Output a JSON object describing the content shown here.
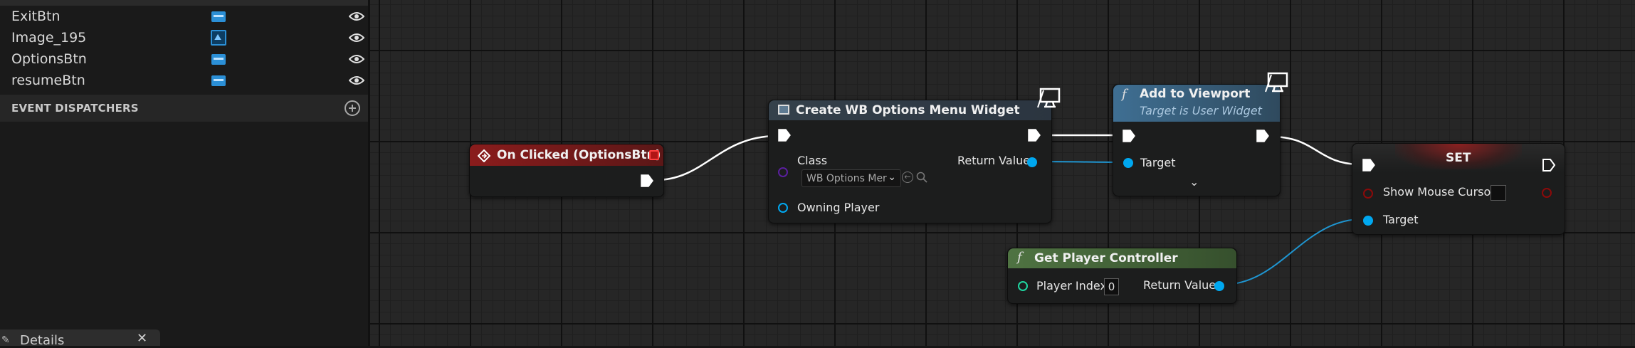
{
  "left_panel": {
    "variables": [
      {
        "name": "ExitBtn",
        "type_icon": "button-widget-icon"
      },
      {
        "name": "Image_195",
        "type_icon": "image-widget-icon"
      },
      {
        "name": "OptionsBtn",
        "type_icon": "button-widget-icon"
      },
      {
        "name": "resumeBtn",
        "type_icon": "button-widget-icon"
      }
    ],
    "section_title": "EVENT DISPATCHERS",
    "details_tab": {
      "label": "Details",
      "close": "✕"
    }
  },
  "graph": {
    "nodes": {
      "on_clicked": {
        "title": "On Clicked (OptionsBtn)",
        "color": "#8a1c1c"
      },
      "create_widget": {
        "title": "Create WB Options Menu Widget",
        "class_label": "Class",
        "class_value": "WB Options Mer",
        "return_label": "Return Value",
        "owning_label": "Owning Player",
        "color": "#2d3a45"
      },
      "add_viewport": {
        "title": "Add to Viewport",
        "subtitle": "Target is User Widget",
        "target_label": "Target",
        "color": "#3a6a8a"
      },
      "set_node": {
        "title": "SET",
        "show_cursor_label": "Show Mouse Cursor",
        "target_label": "Target",
        "color": "#6a1e1e"
      },
      "get_controller": {
        "title": "Get Player Controller",
        "player_index_label": "Player Index",
        "player_index_value": "0",
        "return_label": "Return Value",
        "color": "#4a6b3e"
      }
    },
    "pin_colors": {
      "exec": "#ffffff",
      "object": "#00a8f0",
      "class": "#5a1f9e",
      "bool": "#8c0a0a",
      "int": "#1fd6a0"
    }
  }
}
